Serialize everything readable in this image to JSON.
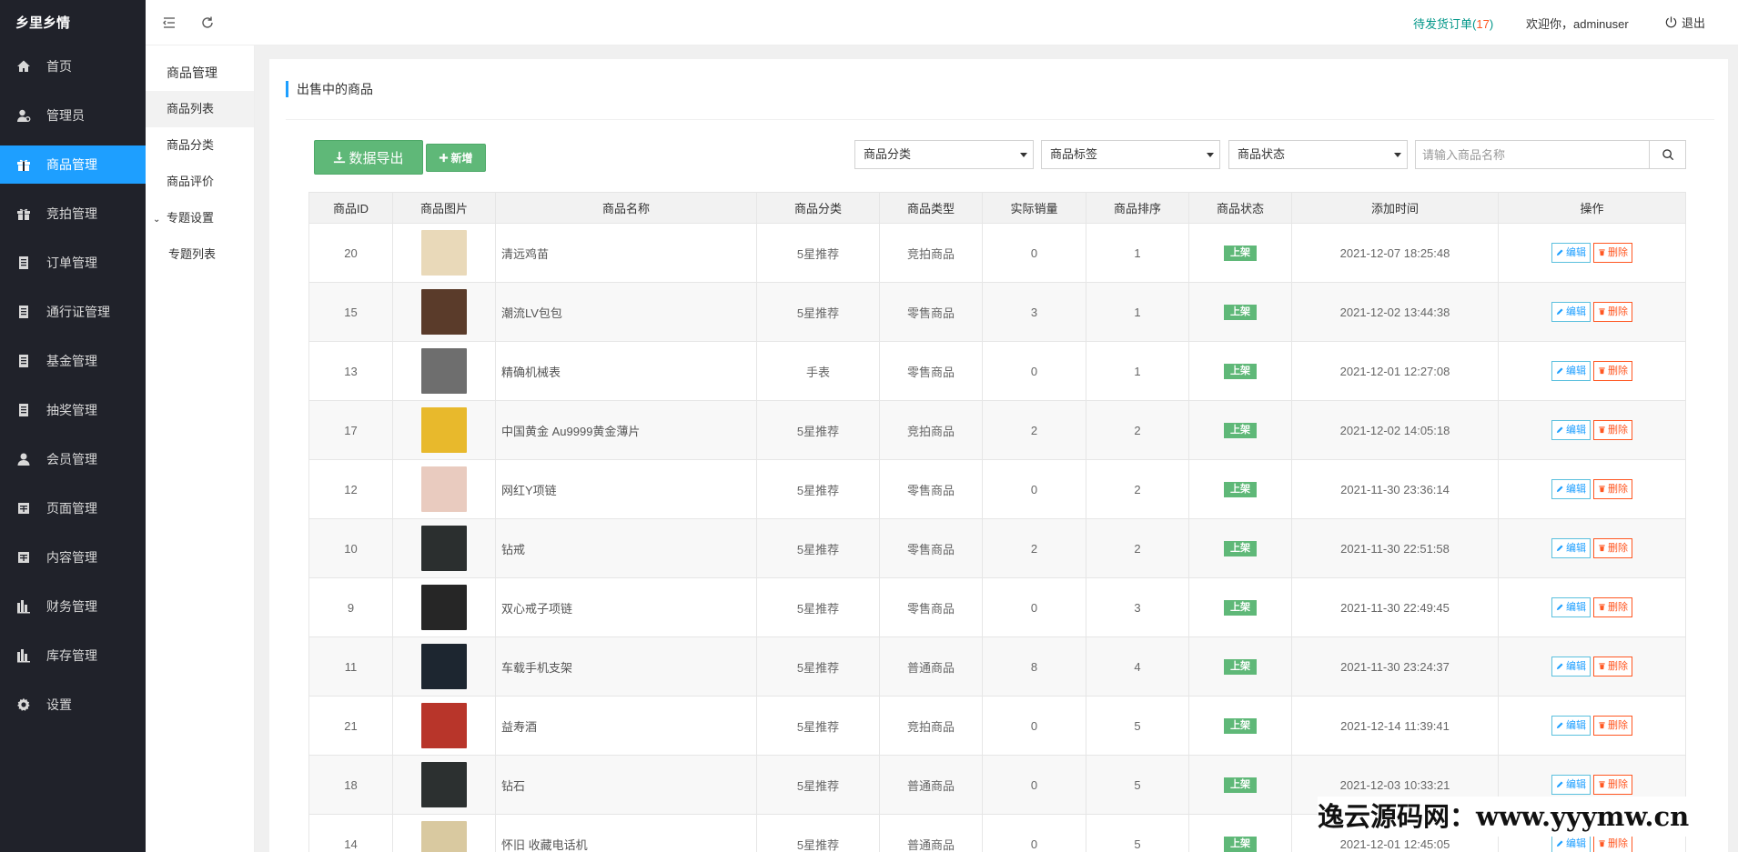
{
  "app": {
    "logo": "乡里乡情"
  },
  "sidebar": {
    "items": [
      {
        "label": "首页",
        "icon": "home-icon"
      },
      {
        "label": "管理员",
        "icon": "user-admin-icon"
      },
      {
        "label": "商品管理",
        "icon": "gift-icon",
        "active": true
      },
      {
        "label": "竞拍管理",
        "icon": "gift-icon"
      },
      {
        "label": "订单管理",
        "icon": "list-icon"
      },
      {
        "label": "通行证管理",
        "icon": "list-icon"
      },
      {
        "label": "基金管理",
        "icon": "list-icon"
      },
      {
        "label": "抽奖管理",
        "icon": "list-icon"
      },
      {
        "label": "会员管理",
        "icon": "user-icon"
      },
      {
        "label": "页面管理",
        "icon": "page-icon"
      },
      {
        "label": "内容管理",
        "icon": "page-icon"
      },
      {
        "label": "财务管理",
        "icon": "bar-icon"
      },
      {
        "label": "库存管理",
        "icon": "bar-icon"
      },
      {
        "label": "设置",
        "icon": "gear-icon"
      }
    ]
  },
  "submenu": {
    "title": "商品管理",
    "items": [
      "商品列表",
      "商品分类",
      "商品评价"
    ],
    "group": "专题设置",
    "group_items": [
      "专题列表"
    ]
  },
  "header": {
    "pending_label": "待发货订单(",
    "pending_count": "17",
    "pending_close": ")",
    "welcome": "欢迎你，adminuser",
    "logout": "退出"
  },
  "card": {
    "title": "出售中的商品",
    "export_label": "数据导出",
    "add_label": "新增",
    "filters": {
      "category": "商品分类",
      "tag": "商品标签",
      "status": "商品状态"
    },
    "search_placeholder": "请输入商品名称"
  },
  "table": {
    "columns": [
      "商品ID",
      "商品图片",
      "商品名称",
      "商品分类",
      "商品类型",
      "实际销量",
      "商品排序",
      "商品状态",
      "添加时间",
      "操作"
    ],
    "edit_label": "编辑",
    "delete_label": "删除",
    "rows": [
      {
        "id": "20",
        "name": "清远鸡苗",
        "category": "5星推荐",
        "type": "竞拍商品",
        "sales": "0",
        "sort": "1",
        "status": "上架",
        "time": "2021-12-07 18:25:48",
        "thumb": "#e9d9b9"
      },
      {
        "id": "15",
        "name": "潮流LV包包",
        "category": "5星推荐",
        "type": "零售商品",
        "sales": "3",
        "sort": "1",
        "status": "上架",
        "time": "2021-12-02 13:44:38",
        "thumb": "#5a3b2a"
      },
      {
        "id": "13",
        "name": "精确机械表",
        "category": "手表",
        "type": "零售商品",
        "sales": "0",
        "sort": "1",
        "status": "上架",
        "time": "2021-12-01 12:27:08",
        "thumb": "#6e6e6e"
      },
      {
        "id": "17",
        "name": "中国黄金 Au9999黄金薄片",
        "category": "5星推荐",
        "type": "竞拍商品",
        "sales": "2",
        "sort": "2",
        "status": "上架",
        "time": "2021-12-02 14:05:18",
        "thumb": "#e8b92c"
      },
      {
        "id": "12",
        "name": "网红Y项链",
        "category": "5星推荐",
        "type": "零售商品",
        "sales": "0",
        "sort": "2",
        "status": "上架",
        "time": "2021-11-30 23:36:14",
        "thumb": "#e9cbbf"
      },
      {
        "id": "10",
        "name": "钻戒",
        "category": "5星推荐",
        "type": "零售商品",
        "sales": "2",
        "sort": "2",
        "status": "上架",
        "time": "2021-11-30 22:51:58",
        "thumb": "#2b2f2f"
      },
      {
        "id": "9",
        "name": "双心戒子项链",
        "category": "5星推荐",
        "type": "零售商品",
        "sales": "0",
        "sort": "3",
        "status": "上架",
        "time": "2021-11-30 22:49:45",
        "thumb": "#262626"
      },
      {
        "id": "11",
        "name": "车载手机支架",
        "category": "5星推荐",
        "type": "普通商品",
        "sales": "8",
        "sort": "4",
        "status": "上架",
        "time": "2021-11-30 23:24:37",
        "thumb": "#1d2630"
      },
      {
        "id": "21",
        "name": "益寿酒",
        "category": "5星推荐",
        "type": "竞拍商品",
        "sales": "0",
        "sort": "5",
        "status": "上架",
        "time": "2021-12-14 11:39:41",
        "thumb": "#b8352a"
      },
      {
        "id": "18",
        "name": "钻石",
        "category": "5星推荐",
        "type": "普通商品",
        "sales": "0",
        "sort": "5",
        "status": "上架",
        "time": "2021-12-03 10:33:21",
        "thumb": "#2c3030"
      },
      {
        "id": "14",
        "name": "怀旧 收藏电话机",
        "category": "5星推荐",
        "type": "普通商品",
        "sales": "0",
        "sort": "5",
        "status": "上架",
        "time": "2021-12-01 12:45:05",
        "thumb": "#d9c9a0"
      }
    ]
  },
  "watermark": "逸云源码网：www.yyymw.cn"
}
